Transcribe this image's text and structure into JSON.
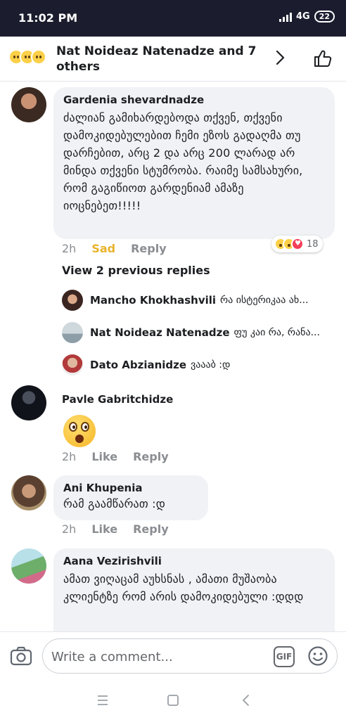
{
  "status_bar": {
    "time": "11:02 PM",
    "network": "4G",
    "battery": "22"
  },
  "header": {
    "title": "Nat Noideaz Natenadze and 7 others",
    "reaction_icons": [
      "laugh-icon",
      "wow-icon",
      "sad-icon"
    ]
  },
  "comments": [
    {
      "author": "Gardenia shevardnadze",
      "text": "ძალიან გამიხარდებოდა თქვენ, თქვენი დამოკიდებულებით ჩემი ეზოს გადაღმა თუ დარჩებით, არც 2 და არც 200 ლარად არ მინდა თქვენი სტუმრობა. რაიმე სამსახური, რომ გაგიწიოთ გარდენიამ ამაზე იოცნებეთ!!!!!",
      "time": "2h",
      "reaction_label": "Sad",
      "reply_label": "Reply",
      "reaction_count": "18"
    },
    {
      "author": "Pavle Gabritchidze",
      "text": "",
      "time": "2h",
      "reaction_label": "Like",
      "reply_label": "Reply"
    },
    {
      "author": "Ani Khupenia",
      "text": "რამ გაამწარათ :დ",
      "time": "2h",
      "reaction_label": "Like",
      "reply_label": "Reply"
    },
    {
      "author": "Aana Vezirishvili",
      "text": "ამათ ვიღაცამ აუხსნას , ამათი მუშაობა კლიენტზე რომ არის დამოკიდებული :დდდ"
    }
  ],
  "view_previous": "View 2 previous replies",
  "replies": [
    {
      "name": "Mancho Khokhashvili",
      "text": "რა ისტერიკაა ახ..."
    },
    {
      "name": "Nat Noideaz Natenadze",
      "text": "ფუ კაი რა, რანა..."
    },
    {
      "name": "Dato Abzianidze",
      "text": "ვაააბ :დ"
    }
  ],
  "composer": {
    "placeholder": "Write a comment...",
    "gif_label": "GIF"
  },
  "colors": {
    "status_bar": "#1b1d2e",
    "bubble": "#f0f2f5",
    "sad_accent": "#e8b32b",
    "muted": "#8a8d91"
  }
}
